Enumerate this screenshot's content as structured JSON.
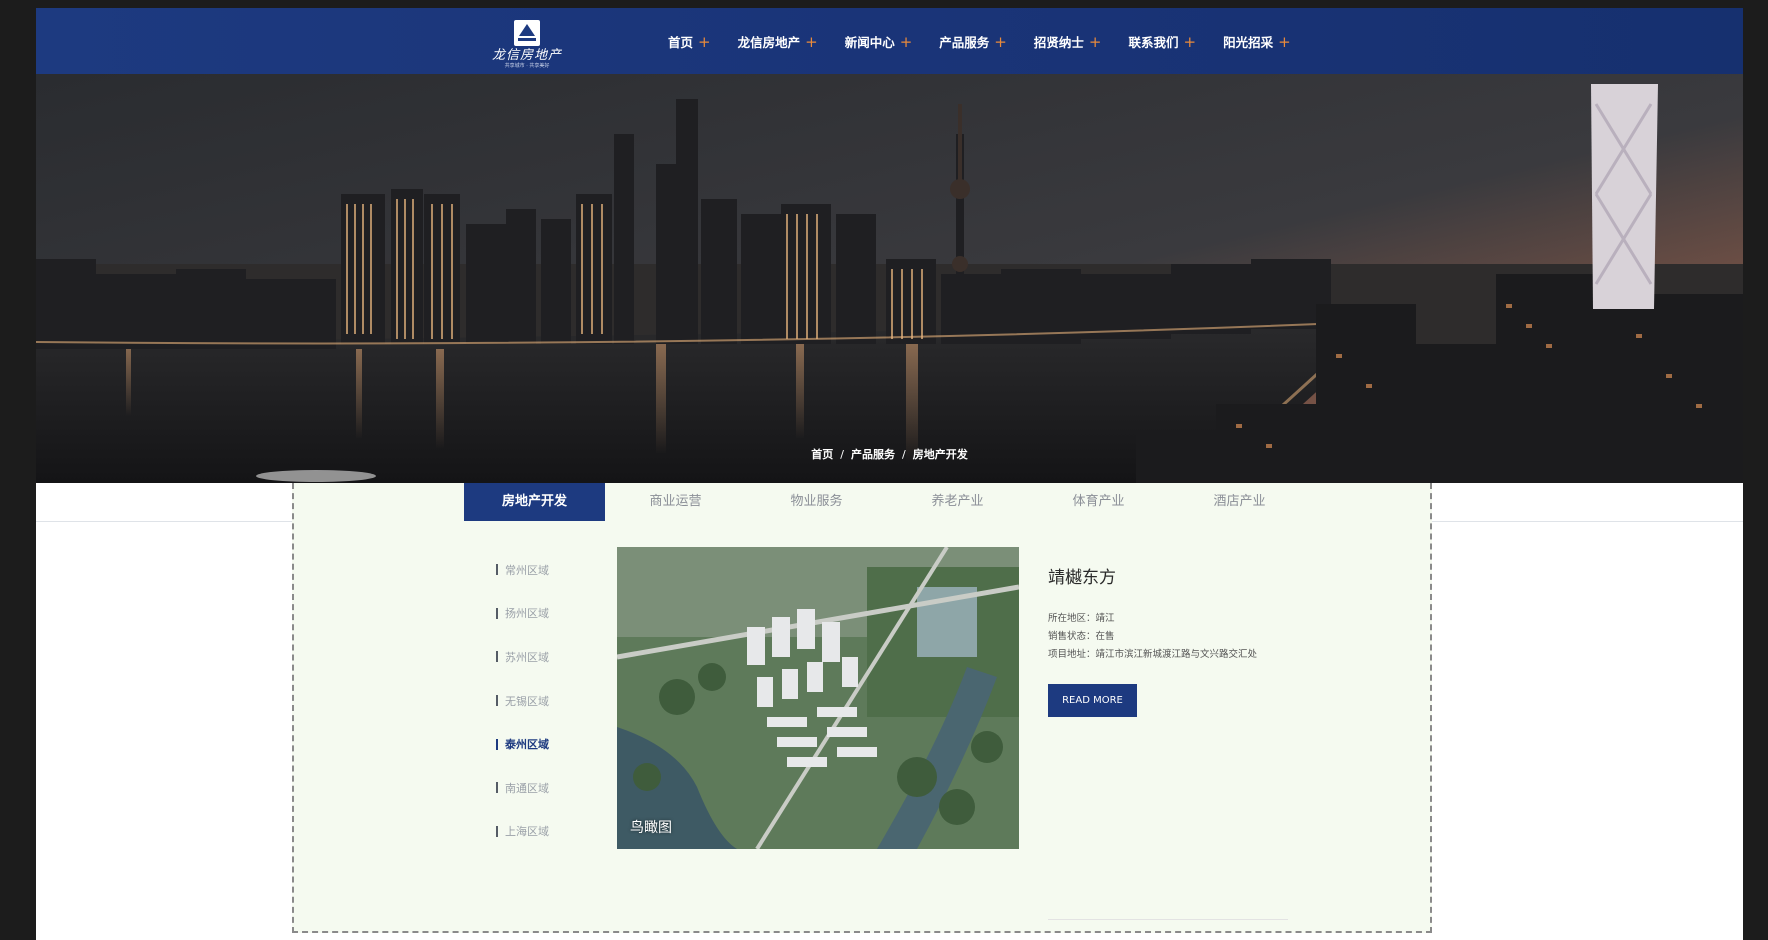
{
  "header": {
    "logo_text": "龙信房地产",
    "logo_sub": "共享城市 · 共享美好",
    "nav": [
      "首页",
      "龙信房地产",
      "新闻中心",
      "产品服务",
      "招贤纳士",
      "联系我们",
      "阳光招采"
    ]
  },
  "breadcrumb": {
    "home": "首页",
    "level1": "产品服务",
    "level2": "房地产开发",
    "separator": "/"
  },
  "tabs": [
    "房地产开发",
    "商业运营",
    "物业服务",
    "养老产业",
    "体育产业",
    "酒店产业"
  ],
  "active_tab": "房地产开发",
  "regions": [
    "常州区域",
    "扬州区域",
    "苏州区域",
    "无锡区域",
    "泰州区域",
    "南通区域",
    "上海区域"
  ],
  "active_region": "泰州区域",
  "project": {
    "title": "靖樾东方",
    "location_label": "所在地区：",
    "location": "靖江",
    "status_label": "销售状态：",
    "status": "在售",
    "address_label": "项目地址：",
    "address": "靖江市滨江新城渡江路与文兴路交汇处",
    "photo_caption": "鸟瞰图",
    "read_more": "READ MORE"
  },
  "colors": {
    "brand": "#1d3a80",
    "accent": "#e98a3b",
    "panel_bg": "#f5faf0"
  },
  "icons": {
    "nav_expand": "plus-icon",
    "logo": "logo-mark-icon"
  }
}
